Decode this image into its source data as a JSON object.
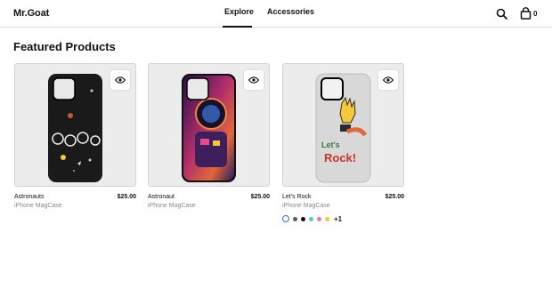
{
  "header": {
    "brand": "Mr.Goat",
    "nav": [
      {
        "label": "Explore",
        "active": true
      },
      {
        "label": "Accessories",
        "active": false
      }
    ],
    "icons": {
      "search": "search-icon",
      "cart": "shopping-bag-icon"
    },
    "cart_count": "0"
  },
  "main": {
    "section_title": "Featured Products",
    "products": [
      {
        "name": "Astronauts",
        "price": "$25.00",
        "subtitle": "iPhone MagCase",
        "case_color": "#1a1a1a",
        "quickview_icon": "eye-icon"
      },
      {
        "name": "Astronaut",
        "price": "$25.00",
        "subtitle": "iPhone MagCase",
        "case_color": "#1a1a1a",
        "quickview_icon": "eye-icon"
      },
      {
        "name": "Let's Rock",
        "price": "$25.00",
        "subtitle": "iPhone MagCase",
        "case_color": "#d8d8d8",
        "quickview_icon": "eye-icon"
      }
    ],
    "swatches": {
      "colors": [
        "#ffffff",
        "#555e6a",
        "#111111",
        "#5ec6c0",
        "#e57aa0",
        "#f2c93a"
      ],
      "selected_index": 0,
      "more_label": "+1"
    }
  },
  "accent_color": "#3b6fd6"
}
